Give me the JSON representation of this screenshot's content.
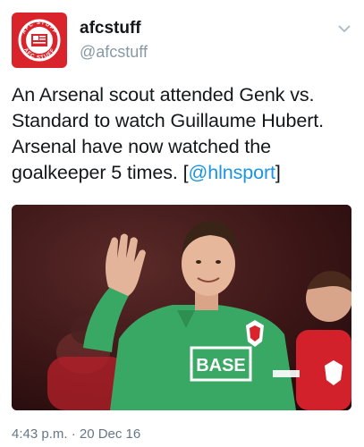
{
  "account": {
    "display_name": "afcstuff",
    "handle": "@afcstuff",
    "avatar_icon": "afcstuff-logo-icon",
    "avatar_text": "AFC STUFF",
    "brand_color": "#d9242c"
  },
  "tweet": {
    "text_main": "An Arsenal scout attended Genk vs. Standard to watch Guillaume Hubert. Arsenal have now watched the goalkeeper 5 times. ",
    "bracket_open": "[",
    "mention": "@hlnsport",
    "bracket_close": "]",
    "mention_color": "#1b95e0"
  },
  "media": {
    "description_icon": "photo-goalkeeper-waving",
    "shirt_text": "BASE",
    "shirt_color": "#3aa865"
  },
  "meta": {
    "timestamp": "4:43 p.m. · 20 Dec 16"
  },
  "menu": {
    "icon": "chevron-down-icon"
  }
}
